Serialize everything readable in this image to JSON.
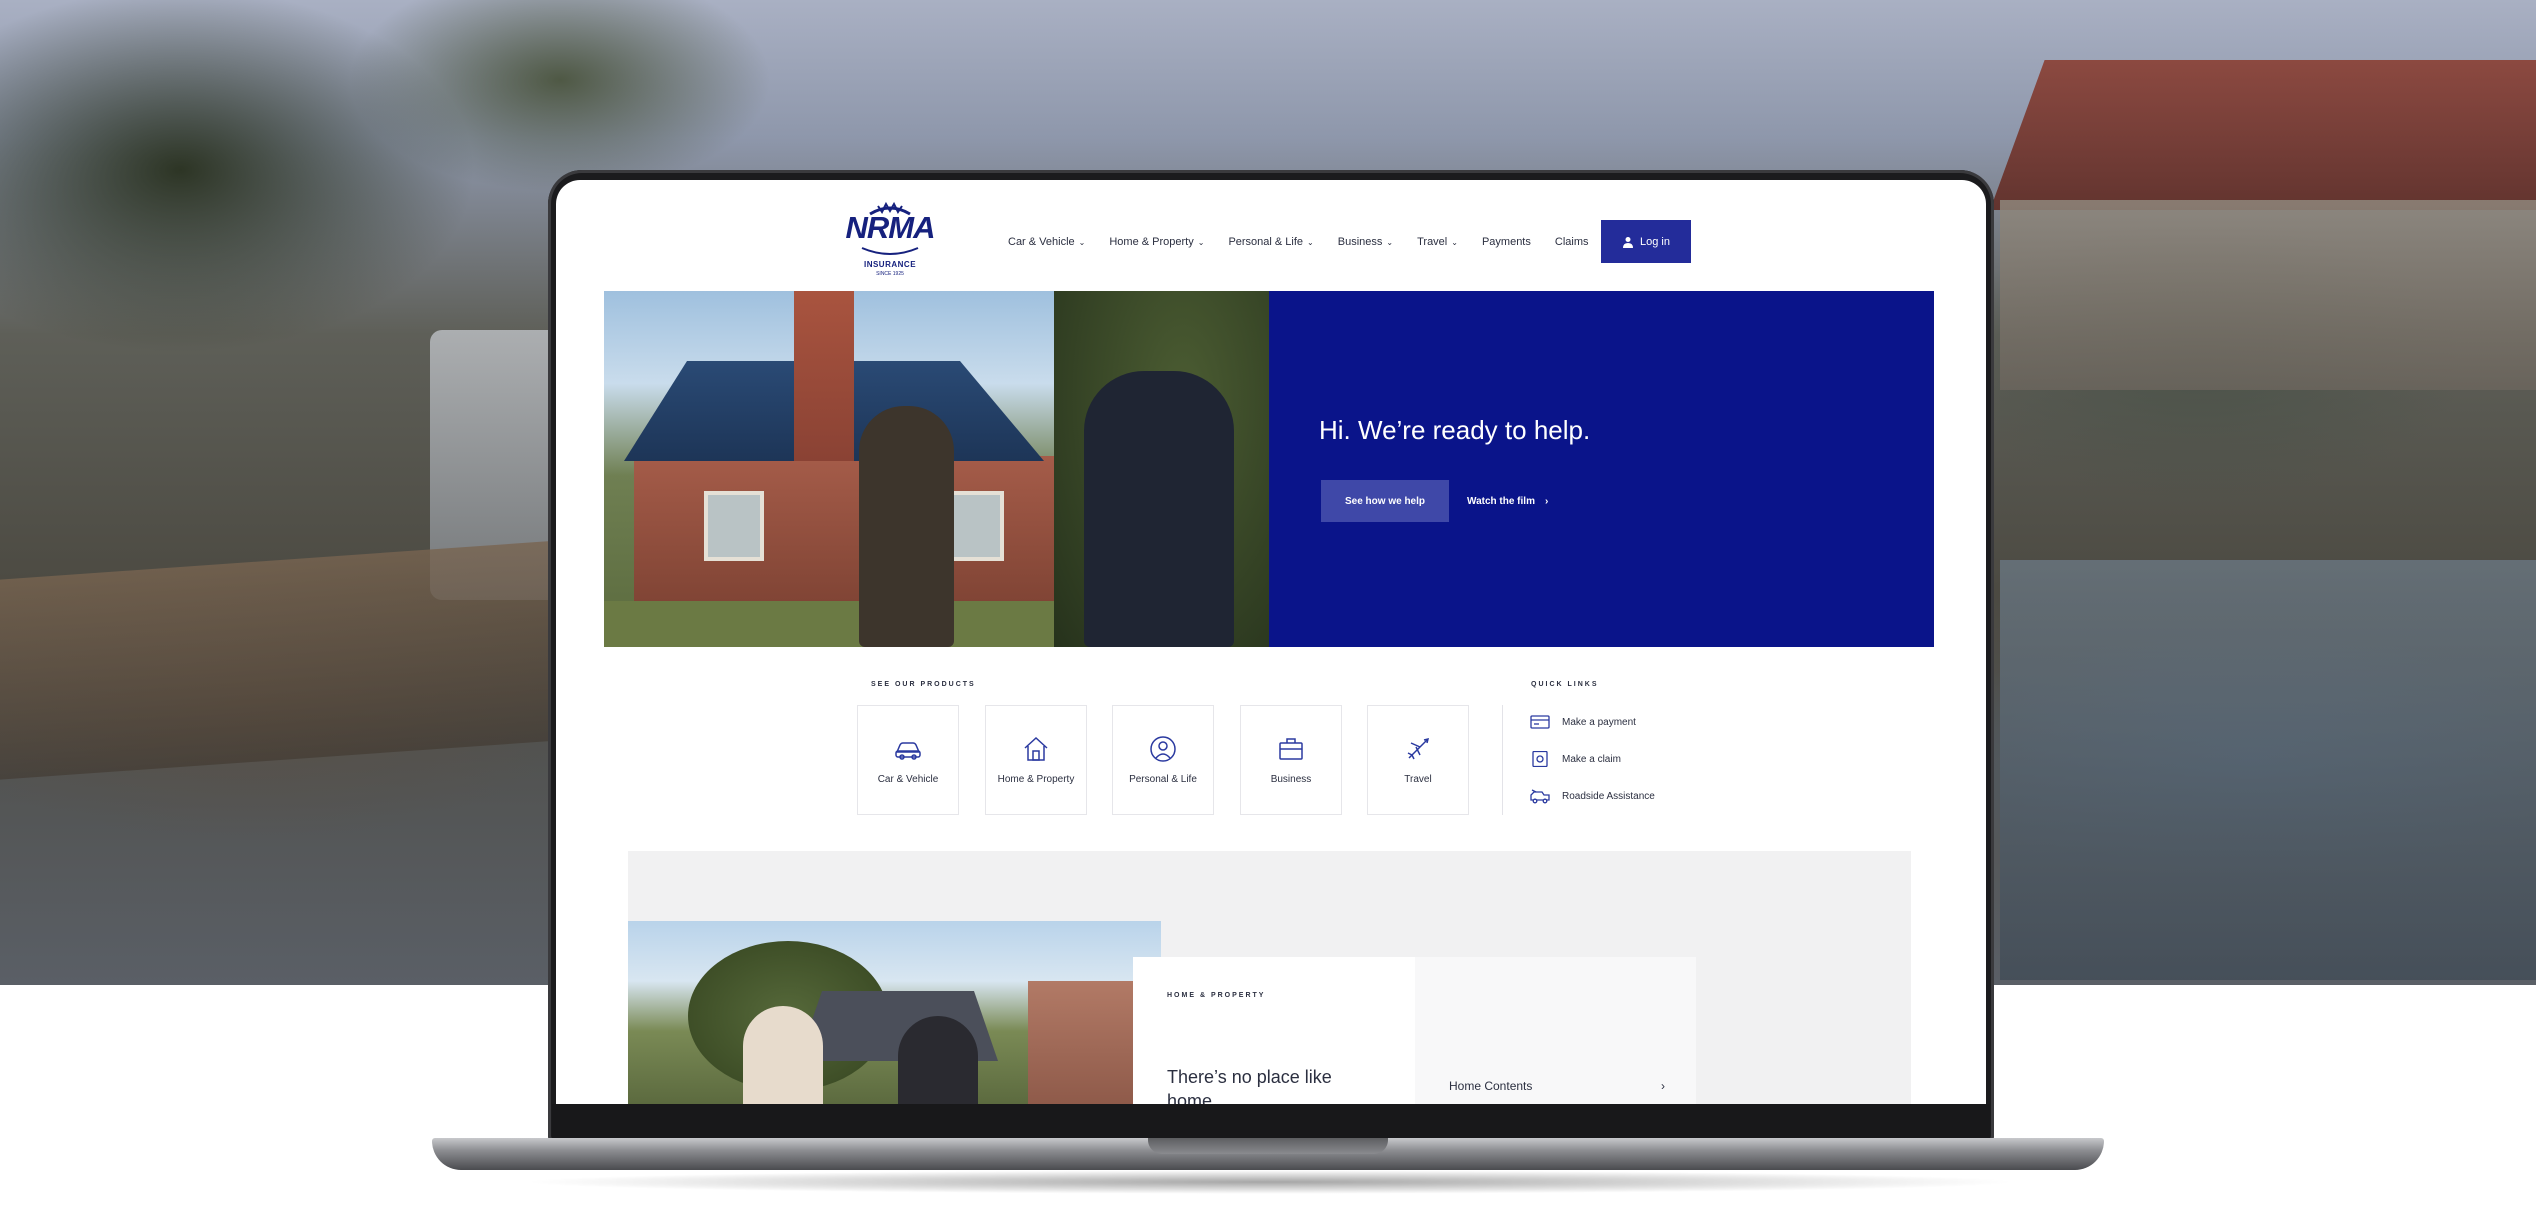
{
  "brand": {
    "logo_text": "NRMA",
    "logo_sub": "INSURANCE",
    "logo_since": "SINCE 1925",
    "primary_color": "#0a148a",
    "button_color": "#232c9a"
  },
  "nav": {
    "items": [
      {
        "label": "Car & Vehicle",
        "has_dropdown": true
      },
      {
        "label": "Home & Property",
        "has_dropdown": true
      },
      {
        "label": "Personal & Life",
        "has_dropdown": true
      },
      {
        "label": "Business",
        "has_dropdown": true
      },
      {
        "label": "Travel",
        "has_dropdown": true
      },
      {
        "label": "Payments",
        "has_dropdown": false
      },
      {
        "label": "Claims",
        "has_dropdown": false
      }
    ],
    "dropdown_glyph": "⌄",
    "login_label": "Log in"
  },
  "hero": {
    "title": "Hi. We’re ready to help.",
    "primary_button": "See how we help",
    "secondary_link": "Watch the film",
    "secondary_arrow": "›"
  },
  "products": {
    "label": "SEE OUR PRODUCTS",
    "items": [
      {
        "label": "Car & Vehicle",
        "icon": "car-icon"
      },
      {
        "label": "Home & Property",
        "icon": "house-icon"
      },
      {
        "label": "Personal & Life",
        "icon": "person-icon"
      },
      {
        "label": "Business",
        "icon": "briefcase-icon"
      },
      {
        "label": "Travel",
        "icon": "plane-icon"
      }
    ]
  },
  "quick_links": {
    "label": "QUICK LINKS",
    "items": [
      {
        "label": "Make a payment",
        "icon": "card-icon"
      },
      {
        "label": "Make a claim",
        "icon": "claim-icon"
      },
      {
        "label": "Roadside Assistance",
        "icon": "tow-truck-icon"
      }
    ]
  },
  "home_property": {
    "eyebrow": "HOME & PROPERTY",
    "title": "There’s no place like home",
    "list_item": "Home Contents",
    "list_arrow": "›"
  }
}
